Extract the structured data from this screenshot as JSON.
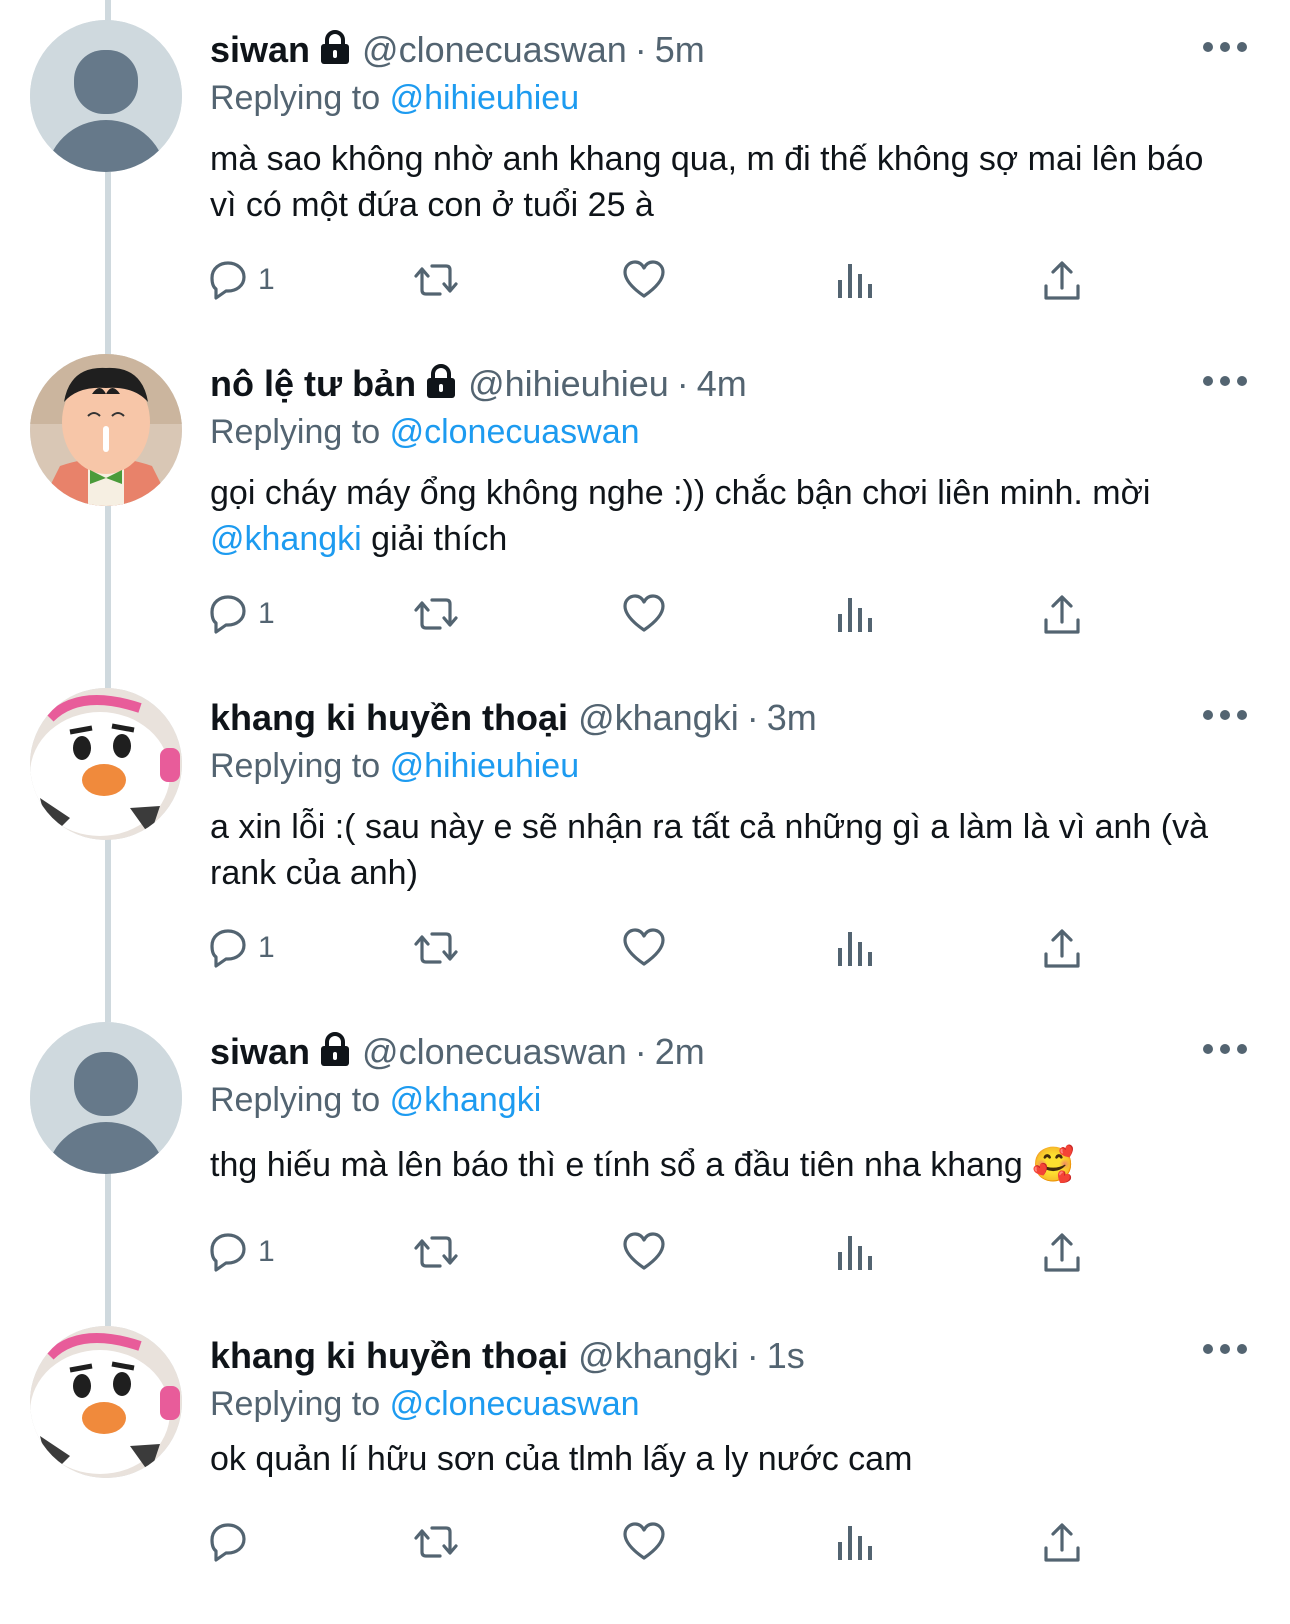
{
  "tweets": [
    {
      "name": "siwan",
      "protected": true,
      "handle": "@clonecuaswan",
      "dot": "·",
      "time": "5m",
      "replying_prefix": "Replying to",
      "replying_to": "@hihieuhieu",
      "text_parts": [
        {
          "text": "mà sao không nhờ anh khang qua, m đi thế không sợ mai lên báo vì có một đứa con ở tuổi 25 à",
          "link": false
        }
      ],
      "reply_count": "1",
      "avatar": "default-avatar-icon"
    },
    {
      "name": "nô lệ tư bản",
      "protected": true,
      "handle": "@hihieuhieu",
      "dot": "·",
      "time": "4m",
      "replying_prefix": "Replying to",
      "replying_to": "@clonecuaswan",
      "text_parts": [
        {
          "text": "gọi cháy máy ổng không nghe :)) chắc bận chơi liên minh. mời ",
          "link": false
        },
        {
          "text": "@khangki",
          "link": true
        },
        {
          "text": " giải thích",
          "link": false
        }
      ],
      "reply_count": "1",
      "avatar": "cartoon-boy-avatar"
    },
    {
      "name": "khang ki huyền thoại",
      "protected": false,
      "handle": "@khangki",
      "dot": "·",
      "time": "3m",
      "replying_prefix": "Replying to",
      "replying_to": "@hihieuhieu",
      "text_parts": [
        {
          "text": "a xin lỗi :( sau này e sẽ nhận ra tất cả những gì a làm là vì anh (và rank của anh)",
          "link": false
        }
      ],
      "reply_count": "1",
      "avatar": "plush-duck-avatar"
    },
    {
      "name": "siwan",
      "protected": true,
      "handle": "@clonecuaswan",
      "dot": "·",
      "time": "2m",
      "replying_prefix": "Replying to",
      "replying_to": "@khangki",
      "text_parts": [
        {
          "text": "thg hiếu mà lên báo thì e tính sổ a đầu tiên nha khang 🥰",
          "link": false
        }
      ],
      "reply_count": "1",
      "avatar": "default-avatar-icon"
    },
    {
      "name": "khang ki huyền thoại",
      "protected": false,
      "handle": "@khangki",
      "dot": "·",
      "time": "1s",
      "replying_prefix": "Replying to",
      "replying_to": "@clonecuaswan",
      "text_parts": [
        {
          "text": "ok quản lí hữu sơn của tlmh lấy a ly nước cam",
          "link": false
        }
      ],
      "reply_count": "",
      "avatar": "plush-duck-avatar"
    }
  ],
  "colors": {
    "link": "#1d9bf0",
    "secondary": "#536471",
    "thread_line": "#cfd9de"
  }
}
